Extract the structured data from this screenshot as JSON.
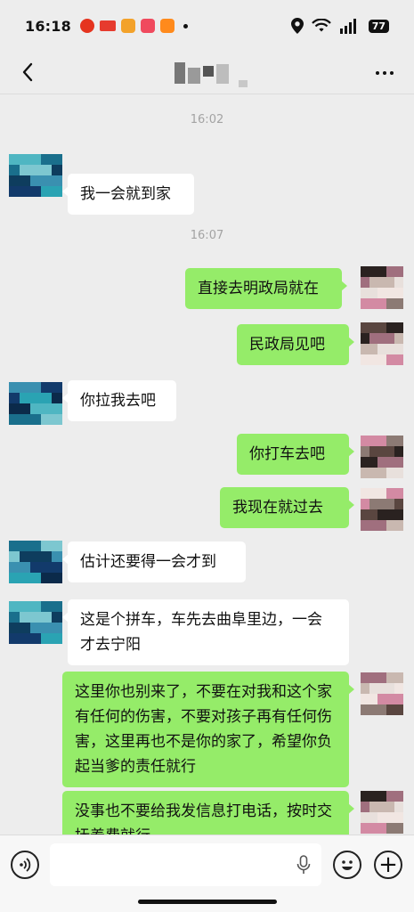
{
  "status_bar": {
    "time": "16:18",
    "battery": "77",
    "notification_icons": [
      "red-app-icon",
      "news-app-icon",
      "orange-app-icon",
      "pink-app-icon",
      "orange-book-icon"
    ],
    "system_icons": [
      "location-icon",
      "wifi-icon",
      "5g-signal-icon",
      "battery-icon"
    ]
  },
  "nav": {
    "back_icon": "chevron-left-icon",
    "more_icon": "more-dots-icon"
  },
  "messages": [
    {
      "type": "timestamp",
      "text": "16:02"
    },
    {
      "type": "message",
      "side": "in",
      "text": "我一会就到家"
    },
    {
      "type": "timestamp",
      "text": "16:07"
    },
    {
      "type": "message",
      "side": "out",
      "text": "直接去明政局就在"
    },
    {
      "type": "message",
      "side": "out",
      "text": "民政局见吧"
    },
    {
      "type": "message",
      "side": "in",
      "text": "你拉我去吧"
    },
    {
      "type": "message",
      "side": "out",
      "text": "你打车去吧"
    },
    {
      "type": "message",
      "side": "out",
      "text": "我现在就过去"
    },
    {
      "type": "message",
      "side": "in",
      "text": "估计还要得一会才到"
    },
    {
      "type": "message",
      "side": "in",
      "text": "这是个拼车，车先去曲阜里边，一会才去宁阳"
    },
    {
      "type": "message",
      "side": "out",
      "text": "这里你也别来了，不要在对我和这个家有任何的伤害，不要对孩子再有任何伤害，这里再也不是你的家了，希望你负起当爹的责任就行"
    },
    {
      "type": "message",
      "side": "out",
      "text": "没事也不要给我发信息打电话，按时交抚养费就行"
    }
  ],
  "input_bar": {
    "voice_icon": "voice-icon",
    "mic_icon": "mic-icon",
    "emoji_icon": "emoji-icon",
    "plus_icon": "plus-icon",
    "plus_glyph": "+"
  },
  "colors": {
    "background": "#ededed",
    "outgoing_bubble": "#95ec69",
    "incoming_bubble": "#ffffff",
    "timestamp": "#a3a3a3"
  }
}
